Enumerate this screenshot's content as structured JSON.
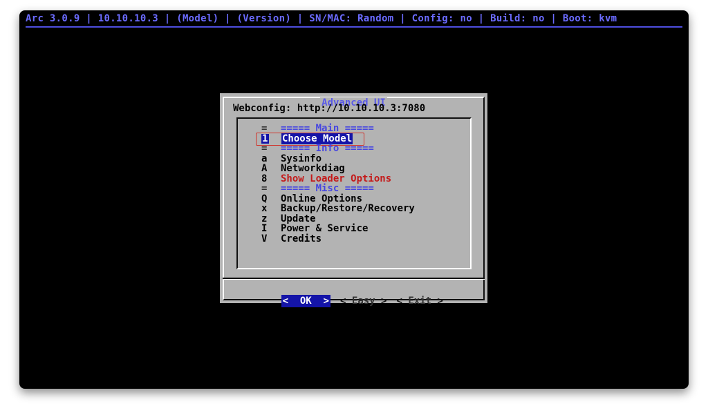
{
  "status_bar": {
    "text": "Arc 3.0.9 | 10.10.10.3 | (Model) | (Version) | SN/MAC: Random | Config: no | Build: no | Boot: kvm"
  },
  "dialog": {
    "title": "Advanced UI",
    "webconfig": "Webconfig: http://10.10.10.3:7080",
    "menu": [
      {
        "key": "=",
        "label": "===== Main =====",
        "type": "separator"
      },
      {
        "key": "1",
        "label": "Choose Model",
        "type": "selected"
      },
      {
        "key": "=",
        "label": "===== Info =====",
        "type": "separator"
      },
      {
        "key": "a",
        "label": "Sysinfo",
        "type": "item"
      },
      {
        "key": "A",
        "label": "Networkdiag",
        "type": "item"
      },
      {
        "key": "8",
        "label": "Show Loader Options",
        "type": "highlight"
      },
      {
        "key": "=",
        "label": "===== Misc =====",
        "type": "separator"
      },
      {
        "key": "Q",
        "label": "Online Options",
        "type": "item"
      },
      {
        "key": "x",
        "label": "Backup/Restore/Recovery",
        "type": "item"
      },
      {
        "key": "z",
        "label": "Update",
        "type": "item"
      },
      {
        "key": "I",
        "label": "Power & Service",
        "type": "item"
      },
      {
        "key": "V",
        "label": "Credits",
        "type": "item"
      }
    ],
    "buttons": {
      "ok": "OK",
      "easy": "Easy",
      "exit": "Exit"
    }
  },
  "colors": {
    "background": "#000000",
    "dialog": "#b3b3b3",
    "accent_blue": "#1414a8",
    "status_text": "#6b6bff",
    "highlight_red": "#c41a1a"
  }
}
